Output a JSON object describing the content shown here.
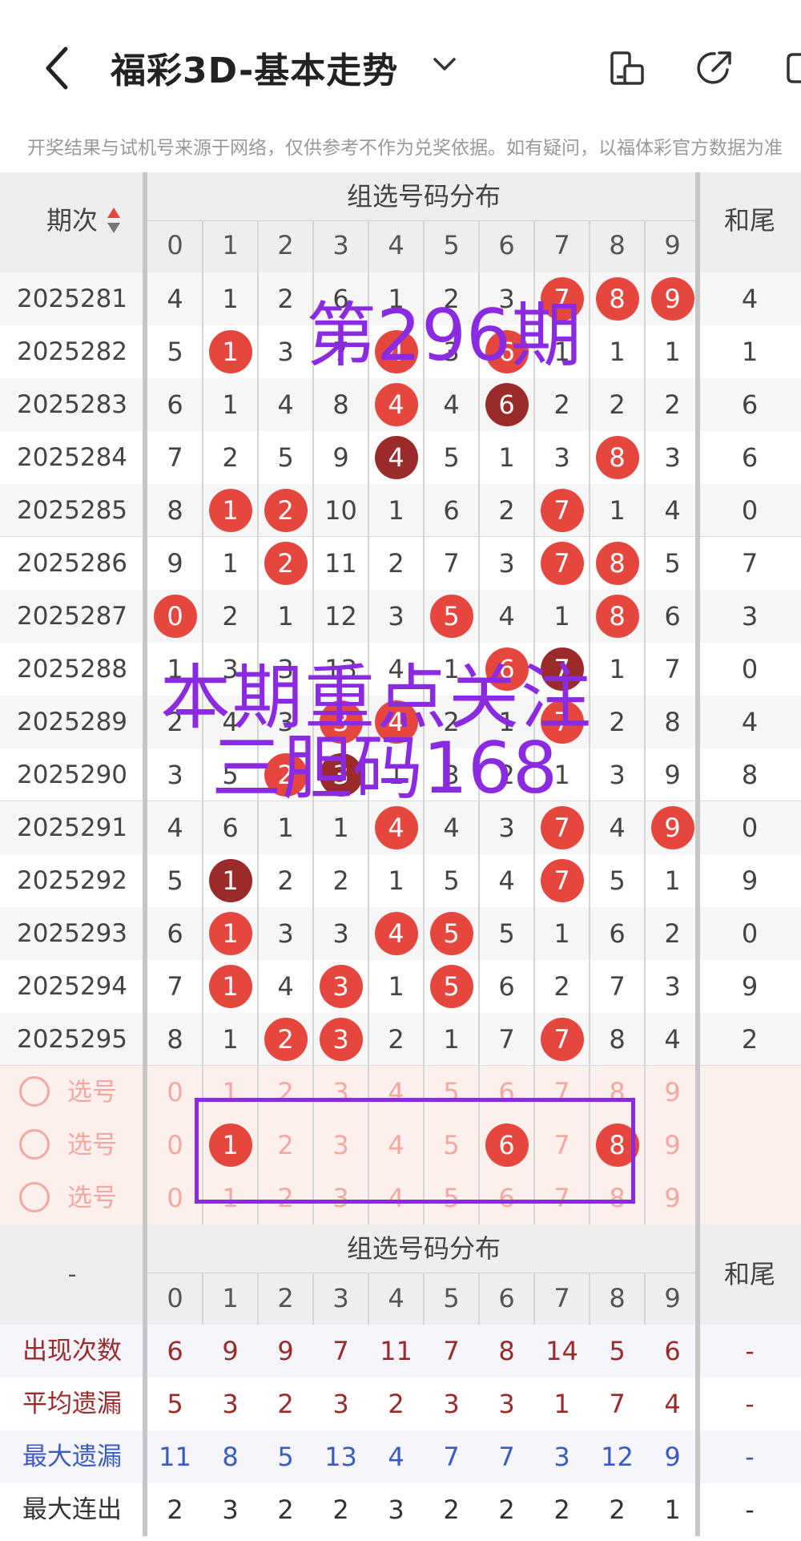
{
  "header": {
    "title": "福彩3D-基本走势",
    "icons": [
      "back-arrow-icon",
      "chevron-down-icon",
      "device-icon",
      "share-icon",
      "more-icon"
    ]
  },
  "notice": "开奖结果与试机号来源于网络，仅供参考不作为兑奖依据。如有疑问，以福体彩官方数据为准",
  "table": {
    "period_header": "期次",
    "dist_header": "组选号码分布",
    "sum_header": "和尾",
    "digits": [
      "0",
      "1",
      "2",
      "3",
      "4",
      "5",
      "6",
      "7",
      "8",
      "9"
    ],
    "rows": [
      {
        "period": "2025281",
        "cells": [
          "4",
          "1",
          "2",
          "6",
          "1",
          "2",
          "3",
          "7",
          "8",
          "9"
        ],
        "balls": [
          7,
          8,
          9
        ],
        "sum": "4"
      },
      {
        "period": "2025282",
        "cells": [
          "5",
          "1",
          "3",
          "7",
          "4",
          "3",
          "6",
          "1",
          "1",
          "1"
        ],
        "balls": [
          1,
          4,
          6
        ],
        "sum": "1"
      },
      {
        "period": "2025283",
        "cells": [
          "6",
          "1",
          "4",
          "8",
          "4",
          "4",
          "6",
          "2",
          "2",
          "2"
        ],
        "balls": [
          4,
          6
        ],
        "dark": [
          6
        ],
        "sum": "6"
      },
      {
        "period": "2025284",
        "cells": [
          "7",
          "2",
          "5",
          "9",
          "4",
          "5",
          "1",
          "3",
          "8",
          "3"
        ],
        "balls": [
          4,
          8
        ],
        "dark": [
          4
        ],
        "sum": "6"
      },
      {
        "period": "2025285",
        "cells": [
          "8",
          "1",
          "2",
          "10",
          "1",
          "6",
          "2",
          "7",
          "1",
          "4"
        ],
        "balls": [
          1,
          2,
          7
        ],
        "sum": "0"
      },
      {
        "period": "2025286",
        "cells": [
          "9",
          "1",
          "2",
          "11",
          "2",
          "7",
          "3",
          "7",
          "8",
          "5"
        ],
        "balls": [
          2,
          7,
          8
        ],
        "sum": "7"
      },
      {
        "period": "2025287",
        "cells": [
          "0",
          "2",
          "1",
          "12",
          "3",
          "5",
          "4",
          "1",
          "8",
          "6"
        ],
        "balls": [
          0,
          5,
          8
        ],
        "sum": "3"
      },
      {
        "period": "2025288",
        "cells": [
          "1",
          "3",
          "3",
          "13",
          "4",
          "1",
          "6",
          "7",
          "1",
          "7"
        ],
        "balls": [
          6,
          7
        ],
        "dark": [
          7
        ],
        "sum": "0"
      },
      {
        "period": "2025289",
        "cells": [
          "2",
          "4",
          "3",
          "3",
          "4",
          "2",
          "1",
          "7",
          "2",
          "8"
        ],
        "balls": [
          3,
          4,
          7
        ],
        "sum": "4"
      },
      {
        "period": "2025290",
        "cells": [
          "3",
          "5",
          "2",
          "3",
          "1",
          "3",
          "2",
          "1",
          "3",
          "9"
        ],
        "balls": [
          2,
          3
        ],
        "dark": [
          3
        ],
        "sum": "8"
      },
      {
        "period": "2025291",
        "cells": [
          "4",
          "6",
          "1",
          "1",
          "4",
          "4",
          "3",
          "7",
          "4",
          "9"
        ],
        "balls": [
          4,
          7,
          9
        ],
        "sum": "0"
      },
      {
        "period": "2025292",
        "cells": [
          "5",
          "1",
          "2",
          "2",
          "1",
          "5",
          "4",
          "7",
          "5",
          "1"
        ],
        "balls": [
          1,
          7
        ],
        "dark": [
          1
        ],
        "sum": "9"
      },
      {
        "period": "2025293",
        "cells": [
          "6",
          "1",
          "3",
          "3",
          "4",
          "5",
          "5",
          "1",
          "6",
          "2"
        ],
        "balls": [
          1,
          4,
          5
        ],
        "sum": "0"
      },
      {
        "period": "2025294",
        "cells": [
          "7",
          "1",
          "4",
          "3",
          "1",
          "5",
          "6",
          "2",
          "7",
          "3"
        ],
        "balls": [
          1,
          3,
          5
        ],
        "sum": "9"
      },
      {
        "period": "2025295",
        "cells": [
          "8",
          "1",
          "2",
          "3",
          "2",
          "1",
          "7",
          "7",
          "8",
          "4"
        ],
        "balls": [
          2,
          3,
          7
        ],
        "sum": "2"
      }
    ],
    "select_rows": [
      {
        "label": "选号",
        "selected": []
      },
      {
        "label": "选号",
        "selected": [
          1,
          6,
          8
        ]
      },
      {
        "label": "选号",
        "selected": []
      }
    ],
    "stats_header_left": "-",
    "stats": [
      {
        "label": "出现次数",
        "values": [
          "6",
          "9",
          "9",
          "7",
          "11",
          "7",
          "8",
          "14",
          "5",
          "6"
        ],
        "sum": "-",
        "color": "#9b2b2b"
      },
      {
        "label": "平均遗漏",
        "values": [
          "5",
          "3",
          "2",
          "3",
          "2",
          "3",
          "3",
          "1",
          "7",
          "4"
        ],
        "sum": "-",
        "color": "#9b2b2b"
      },
      {
        "label": "最大遗漏",
        "values": [
          "11",
          "8",
          "5",
          "13",
          "4",
          "7",
          "7",
          "3",
          "12",
          "9"
        ],
        "sum": "-",
        "color": "#3a5bbf"
      },
      {
        "label": "最大连出",
        "values": [
          "2",
          "3",
          "2",
          "2",
          "3",
          "2",
          "2",
          "2",
          "2",
          "1"
        ],
        "sum": "-",
        "color": "#333333"
      }
    ]
  },
  "overlay": {
    "issue": "第296期",
    "focus_line1": "本期重点关注",
    "focus_line2": "三胆码168",
    "color": "#8a2be2"
  },
  "colors": {
    "ball": "#e5473f",
    "ball_dark": "#9b2b2b",
    "select_bg": "#fdf0ec",
    "select_text": "#f2a8a0"
  }
}
